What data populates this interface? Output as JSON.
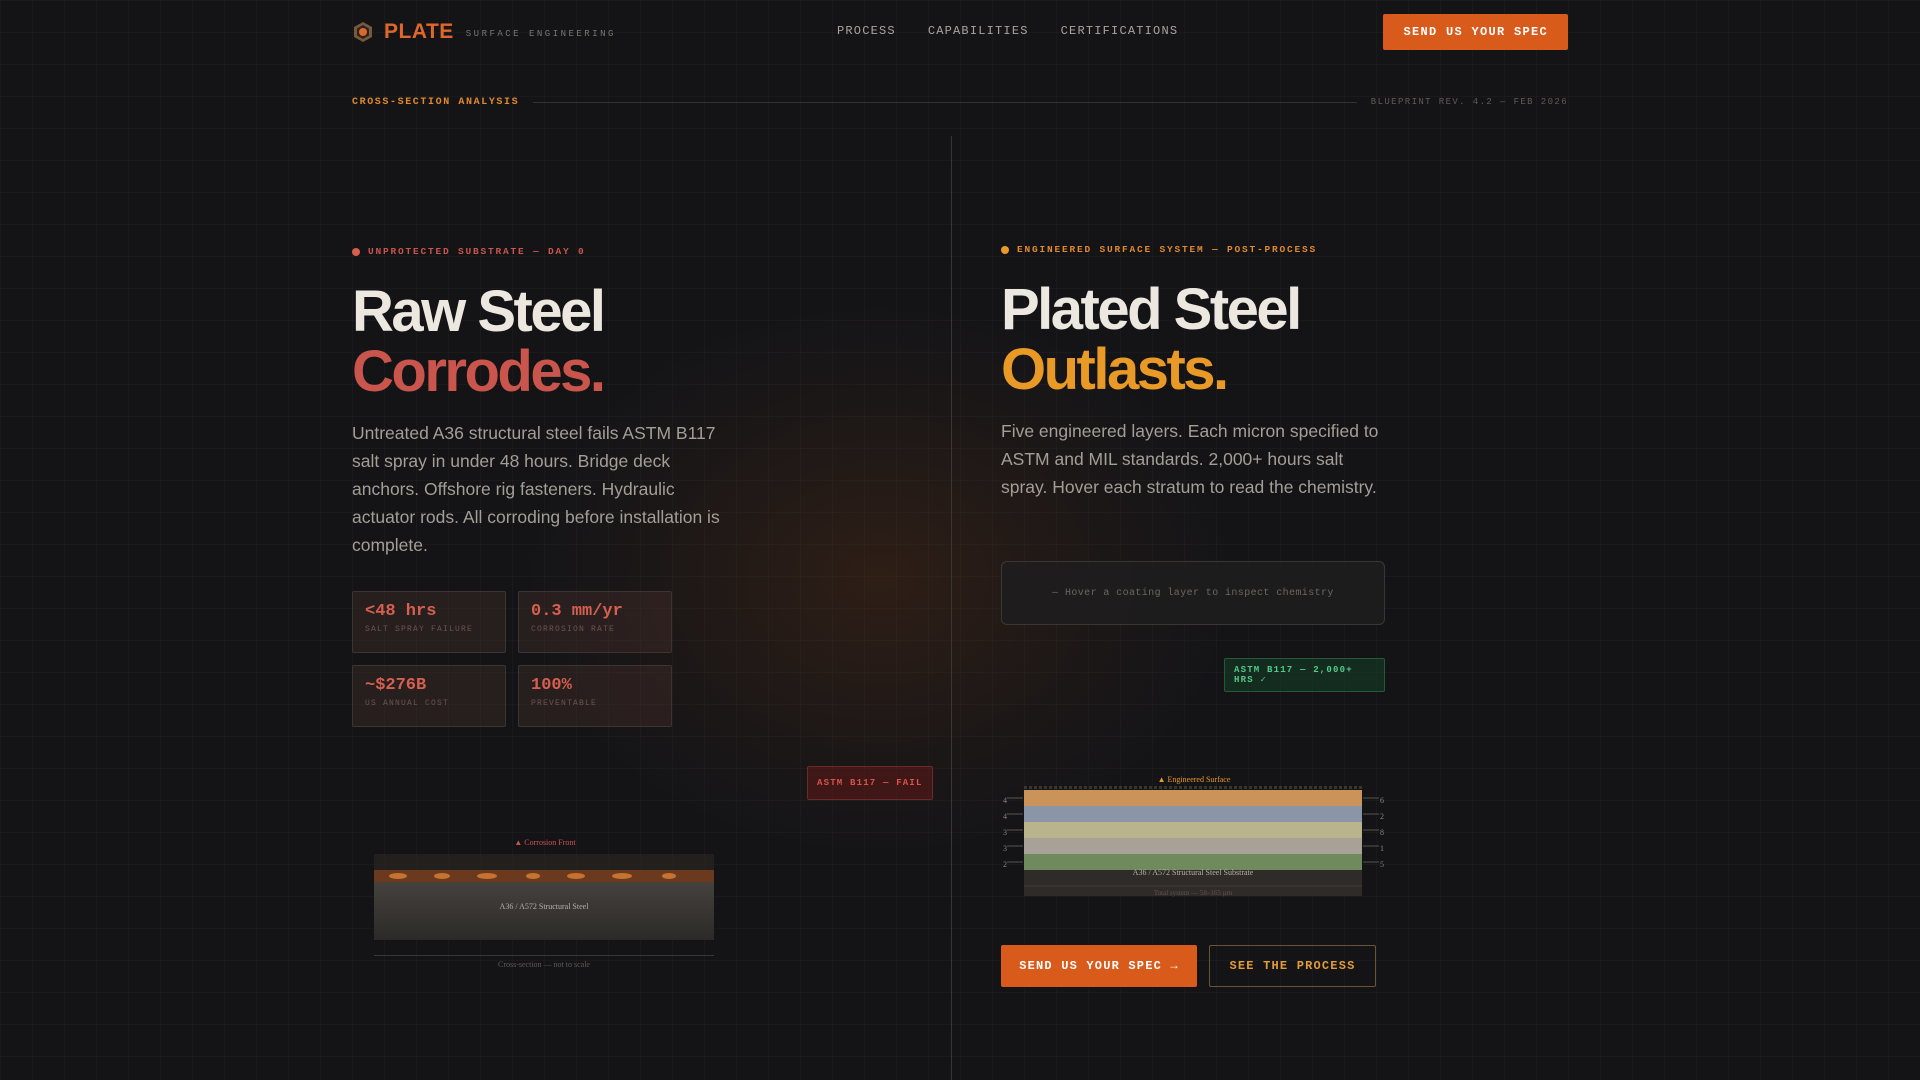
{
  "nav": {
    "brand": "PLATE",
    "brand_sub": "SURFACE ENGINEERING",
    "links": [
      "PROCESS",
      "CAPABILITIES",
      "CERTIFICATIONS"
    ],
    "cta": "SEND US YOUR SPEC"
  },
  "section": {
    "label": "CROSS-SECTION ANALYSIS",
    "revision": "BLUEPRINT REV. 4.2 — FEB 2026"
  },
  "left": {
    "tag": "UNPROTECTED SUBSTRATE — DAY 0",
    "title_line1": "Raw Steel",
    "title_line2": "Corrodes.",
    "lead": "Untreated A36 structural steel fails ASTM B117 salt spray in under 48 hours. Bridge deck anchors. Offshore rig fasteners. Hydraulic actuator rods. All corroding before installation is complete.",
    "stats": [
      {
        "value": "<48 hrs",
        "label": "SALT SPRAY FAILURE"
      },
      {
        "value": "0.3 mm/yr",
        "label": "CORROSION RATE"
      },
      {
        "value": "~$276B",
        "label": "US ANNUAL COST"
      },
      {
        "value": "100%",
        "label": "PREVENTABLE"
      }
    ],
    "badge": "ASTM B117 — FAIL",
    "diagram": {
      "top_label": "▲ Corrosion Front",
      "substrate_label": "A36 / A572 Structural Steel",
      "caption": "Cross-section — not to scale"
    },
    "colors": {
      "accent": "#d65f4f",
      "title_accent": "#c9554d"
    }
  },
  "right": {
    "tag": "ENGINEERED SURFACE SYSTEM — POST-PROCESS",
    "title_line1": "Plated Steel",
    "title_line2": "Outlasts.",
    "lead": "Five engineered layers. Each micron specified to ASTM and MIL standards. 2,000+ hours salt spray. Hover each stratum to read the chemistry.",
    "inspector_placeholder": "— Hover a coating layer to inspect chemistry",
    "badge": "ASTM B117 — 2,000+ HRS ✓",
    "diagram": {
      "top_label": "▲ Engineered Surface",
      "substrate_label": "A36 / A572 Structural Steel Substrate",
      "footer_label": "Total system — 58–165 µm",
      "left_ticks": [
        "4",
        "4",
        "3",
        "3",
        "2"
      ],
      "right_ticks": [
        "6",
        "2",
        "8",
        "1",
        "5"
      ],
      "layers": [
        "#c9935a",
        "#8a96a8",
        "#b9b48c",
        "#a8a198",
        "#6f8a5c"
      ]
    },
    "cta_primary": "SEND US YOUR SPEC →",
    "cta_secondary": "SEE THE PROCESS",
    "colors": {
      "title_accent": "#e99a26",
      "tag": "#e0892f"
    }
  }
}
